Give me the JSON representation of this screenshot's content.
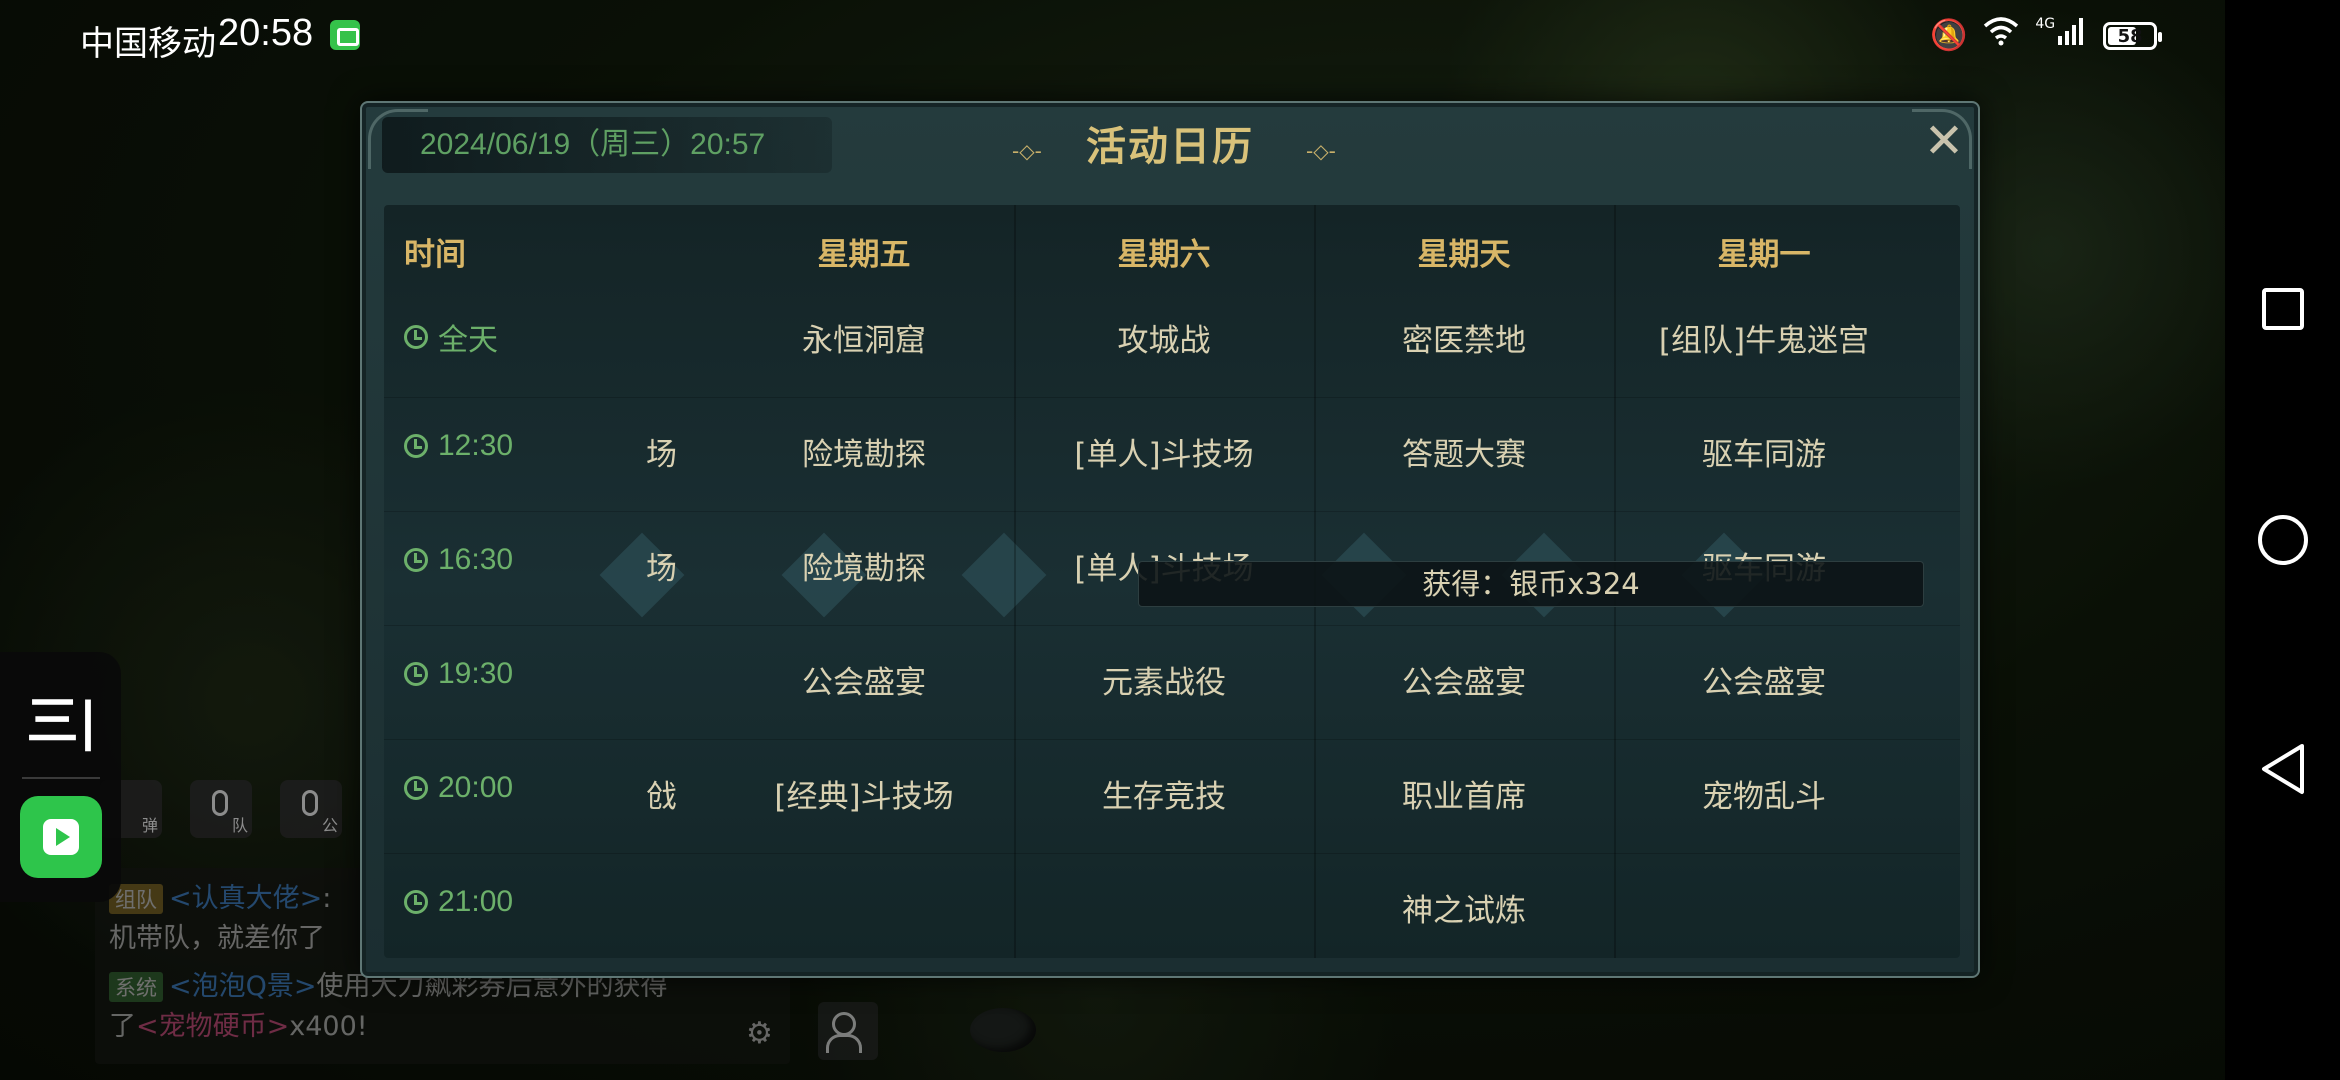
{
  "status_bar": {
    "carrier": "中国移动",
    "time": "20:58",
    "network": "4G",
    "battery": "58"
  },
  "chat": {
    "icon_labels": [
      "弹",
      "队",
      "公"
    ],
    "lines": [
      {
        "tag": "组队",
        "name": "<认真大佬>",
        "text": ":"
      },
      {
        "tag": "",
        "name": "",
        "text": "机带队，就差你了"
      },
      {
        "tag": "系统",
        "name": "<泡泡Q景>",
        "text": "使用大力飙彩券后意外的获得"
      },
      {
        "tag": "",
        "name": "",
        "text": "了",
        "item": "<宠物硬币>",
        "suffix": "x400!"
      }
    ]
  },
  "calendar": {
    "title": "活动日历",
    "datetime": "2024/06/19（周三）20:57",
    "time_header": "时间",
    "days": [
      "星期五",
      "星期六",
      "星期天",
      "星期一"
    ],
    "rows": [
      {
        "time": "全天",
        "partial": "",
        "cells": [
          "永恒洞窟",
          "攻城战",
          "密医禁地",
          "[组队]牛鬼迷宫"
        ]
      },
      {
        "time": "12:30",
        "partial": "场",
        "cells": [
          "险境勘探",
          "[单人]斗技场",
          "答题大赛",
          "驱车同游"
        ]
      },
      {
        "time": "16:30",
        "partial": "场",
        "cells": [
          "险境勘探",
          "[单人]斗技场",
          "",
          "驱车同游"
        ]
      },
      {
        "time": "19:30",
        "partial": "",
        "cells": [
          "公会盛宴",
          "元素战役",
          "公会盛宴",
          "公会盛宴"
        ]
      },
      {
        "time": "20:00",
        "partial": "戗",
        "cells": [
          "[经典]斗技场",
          "生存竞技",
          "职业首席",
          "宠物乱斗"
        ]
      },
      {
        "time": "21:00",
        "partial": "",
        "cells": [
          "",
          "",
          "神之试炼",
          ""
        ]
      }
    ],
    "reward_toast": "获得：银币x324"
  },
  "float_widget": {
    "top_glyph": "三|"
  }
}
